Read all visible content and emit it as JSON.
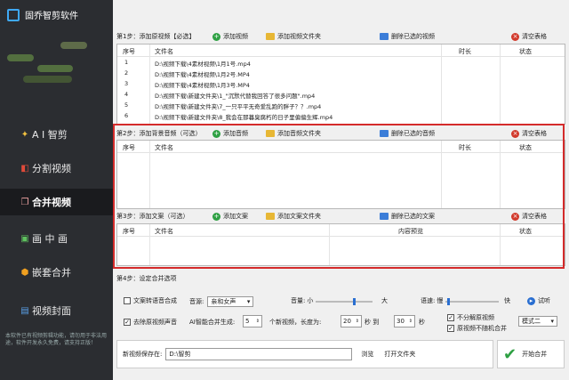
{
  "app": {
    "title": "固乔智剪软件"
  },
  "sidebar": {
    "items": [
      {
        "label": "A I 智剪",
        "icon": "ai-star-icon"
      },
      {
        "label": "分割视频",
        "icon": "split-layers-icon"
      },
      {
        "label": "合并视频",
        "icon": "merge-pages-icon"
      },
      {
        "label": "画 中 画",
        "icon": "picture-in-picture-icon"
      },
      {
        "label": "嵌套合并",
        "icon": "nest-shield-icon"
      },
      {
        "label": "视频封面",
        "icon": "cover-image-icon"
      }
    ],
    "note": "本软件已有视频剪辑功能，请勿用于非法用途，软件开发永久免费，请支持正版！"
  },
  "step1": {
    "label": "第1步：添加原视频【必选】",
    "add_video": "添加视频",
    "add_folder": "添加视频文件夹",
    "delete_selected": "删除已选的视频",
    "clear": "清空表格",
    "columns": [
      "序号",
      "文件名",
      "时长",
      "状态"
    ],
    "rows": [
      {
        "idx": "1",
        "file": "D:\\视频下载\\4素材视频\\1月1号.mp4"
      },
      {
        "idx": "2",
        "file": "D:\\视频下载\\4素材视频\\1月2号.MP4"
      },
      {
        "idx": "3",
        "file": "D:\\视频下载\\4素材视频\\1月3号.MP4"
      },
      {
        "idx": "4",
        "file": "D:\\视频下载\\新建文件夹\\1_\"沉默代替我回答了很多问题\".mp4"
      },
      {
        "idx": "5",
        "file": "D:\\视频下载\\新建文件夹\\7_一只平平无奇爱乱跑的胖子？？.mp4"
      },
      {
        "idx": "6",
        "file": "D:\\视频下载\\新建文件夹\\8_我会在那暮臭腐朽的日子里偏偏生辉.mp4"
      }
    ]
  },
  "step2": {
    "label": "第2步：添加背景音频（可选）",
    "add": "添加音频",
    "add_folder": "添加音频文件夹",
    "delete_selected": "删除已选的音频",
    "clear": "清空表格",
    "columns": [
      "序号",
      "文件名",
      "时长",
      "状态"
    ]
  },
  "step3": {
    "label": "第3步：添加文案（可选）",
    "add": "添加文案",
    "add_folder": "添加文案文件夹",
    "delete_selected": "删除已选的文案",
    "clear": "清空表格",
    "columns": [
      "序号",
      "文件名",
      "内容预览",
      "状态"
    ]
  },
  "step4": {
    "label": "第4步：设定合并选项"
  },
  "options": {
    "tts_label": "文案转语音合成",
    "voice_label": "音源:",
    "voice_value": "亲和女声",
    "volume_label": "音量:",
    "volume_small": "小",
    "volume_big": "大",
    "speed_label": "语速:",
    "speed_slow": "慢",
    "speed_fast": "快",
    "preview": "试听",
    "mute_label": "去除原视频声音",
    "ai_gen_label": "AI智能合并生成:",
    "ai_gen_value": "5",
    "count_label": "个新视频，长度为:",
    "len_min": "20",
    "sec_to": "秒 到",
    "len_max": "30",
    "sec": "秒",
    "no_split": "不分解原视频",
    "no_random": "原视频不随机合并",
    "mode_value": "模式二",
    "save_label": "新视频保存在:",
    "save_path": "D:\\智剪",
    "browse": "浏览",
    "open_folder": "打开文件夹",
    "start": "开始合并"
  },
  "colors": {
    "sidebar_bg": "#2b2d31",
    "accent_red": "#d42b2b",
    "accent_green": "#2ea043"
  }
}
